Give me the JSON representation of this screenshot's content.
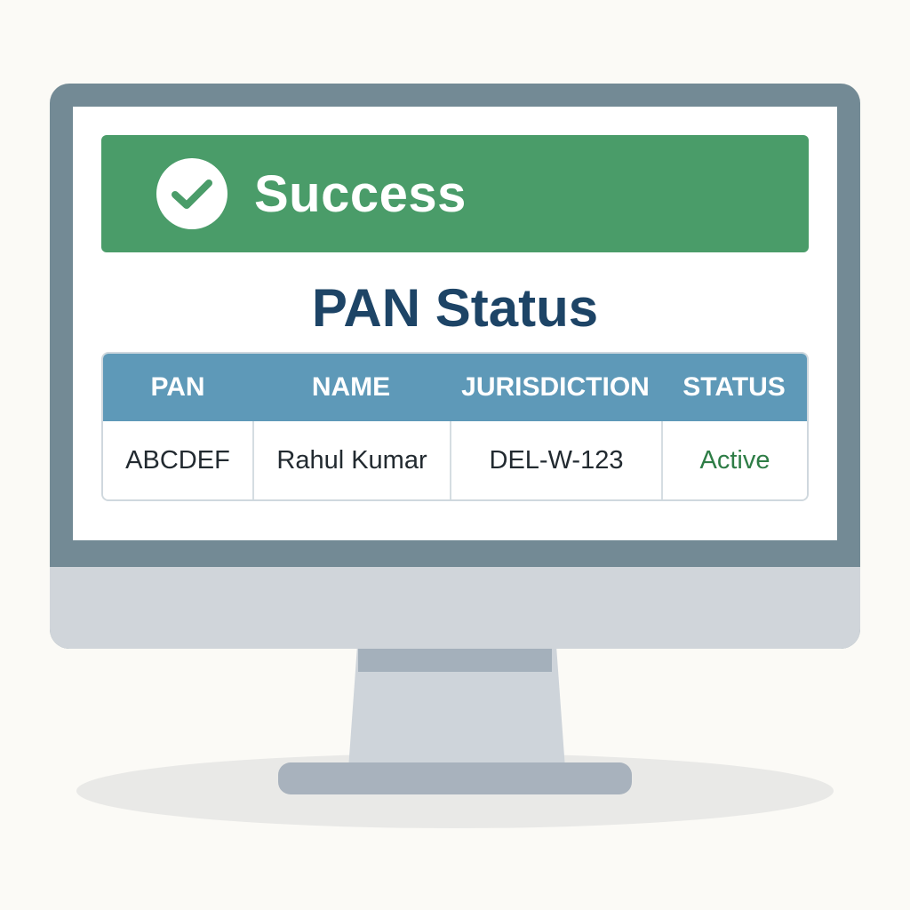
{
  "banner": {
    "icon": "check-circle-icon",
    "text": "Success",
    "color": "#4a9c69"
  },
  "title": "PAN Status",
  "table": {
    "columns": [
      "PAN",
      "NAME",
      "JURISDICTION",
      "STATUS"
    ],
    "rows": [
      {
        "pan": "ABCDEF",
        "name": "Rahul Kumar",
        "jurisdiction": "DEL-W-123",
        "status": "Active"
      }
    ],
    "header_color": "#5e99b8",
    "status_active_color": "#2e7d46"
  }
}
